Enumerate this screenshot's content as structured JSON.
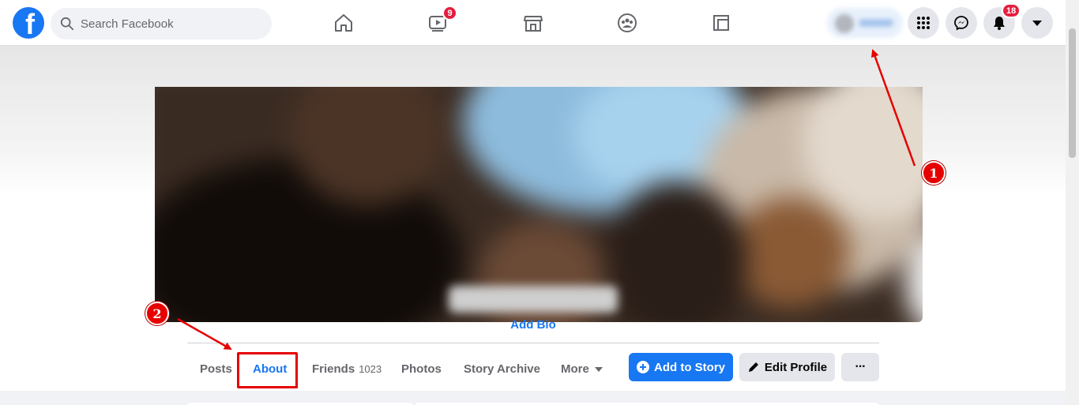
{
  "topbar": {
    "search": {
      "placeholder": "Search Facebook"
    },
    "watch_badge": "9",
    "notifications_badge": "18",
    "nav_icons": [
      "home-icon",
      "watch-icon",
      "marketplace-icon",
      "groups-icon",
      "gaming-icon"
    ],
    "right_icons": [
      "menu-grid-icon",
      "messenger-icon",
      "bell-icon",
      "account-caret-icon"
    ]
  },
  "profile": {
    "add_bio": "Add Bio"
  },
  "tabs": [
    {
      "label": "Posts"
    },
    {
      "label": "About",
      "active": true
    },
    {
      "label": "Friends",
      "count": "1023"
    },
    {
      "label": "Photos"
    },
    {
      "label": "Story Archive"
    },
    {
      "label": "More"
    }
  ],
  "actions": {
    "add_story": "Add to Story",
    "edit_profile": "Edit Profile",
    "more": "···"
  },
  "annotations": {
    "marker_1": "1",
    "marker_2": "2"
  },
  "colors": {
    "brand": "#1877f2",
    "badge": "#e41e3f",
    "annotation": "#e60000"
  }
}
